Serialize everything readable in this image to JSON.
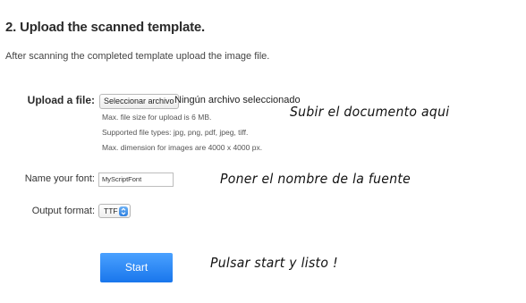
{
  "section": {
    "title": "2. Upload the scanned template.",
    "description": "After scanning the completed template upload the image file."
  },
  "upload": {
    "label": "Upload a file:",
    "button_label": "Seleccionar archivo",
    "status": "Ningún archivo seleccionado",
    "hints": [
      "Max. file size for upload is 6 MB.",
      "Supported file types: jpg, png, pdf, jpeg, tiff.",
      "Max. dimension for images are 4000 x 4000 px."
    ]
  },
  "font_name": {
    "label": "Name your font:",
    "value": "MyScriptFont"
  },
  "output": {
    "label": "Output format:",
    "selected": "TTF"
  },
  "start": {
    "label": "Start"
  },
  "annotations": {
    "upload_note": "Subir el documento aqui",
    "font_note": "Poner el nombre de la fuente",
    "start_note": "Pulsar start y listo !"
  },
  "colors": {
    "accent": "#1f7ff0",
    "text": "#333333"
  },
  "icons": {
    "select_arrows": "chevron-up-down-icon"
  }
}
